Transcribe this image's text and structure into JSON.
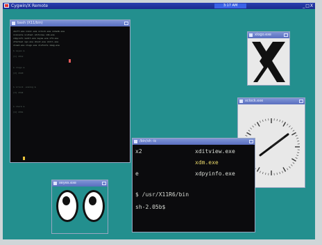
{
  "desktop": {
    "title": "Cygwin/X Remote",
    "clock": "3:17 AM",
    "controls": "_□X"
  },
  "windows": {
    "xterm_main": {
      "title": "bash (X11/bin)"
    },
    "xlogo": {
      "title": "xlogo.exe"
    },
    "xclock": {
      "title": "xclock.exe"
    },
    "xterm_front": {
      "title": "/bin/sh -ic",
      "rows": [
        {
          "c1": "x2",
          "c2": "xditview.exe"
        },
        {
          "c1": "",
          "c2": "xdm.exe"
        },
        {
          "c1": "e",
          "c2": "xdpyinfo.exe"
        },
        {
          "c1": "",
          "c2": ""
        },
        {
          "c1": "",
          "c2": "/usr/X11R6/bin"
        },
        {
          "c1": "",
          "c2": ""
        }
      ],
      "prompt_line": "$ /usr/X11R6/bin",
      "last_line": "sh-2.05b$ "
    },
    "xeyes": {
      "title": "xeyes.exe"
    }
  }
}
